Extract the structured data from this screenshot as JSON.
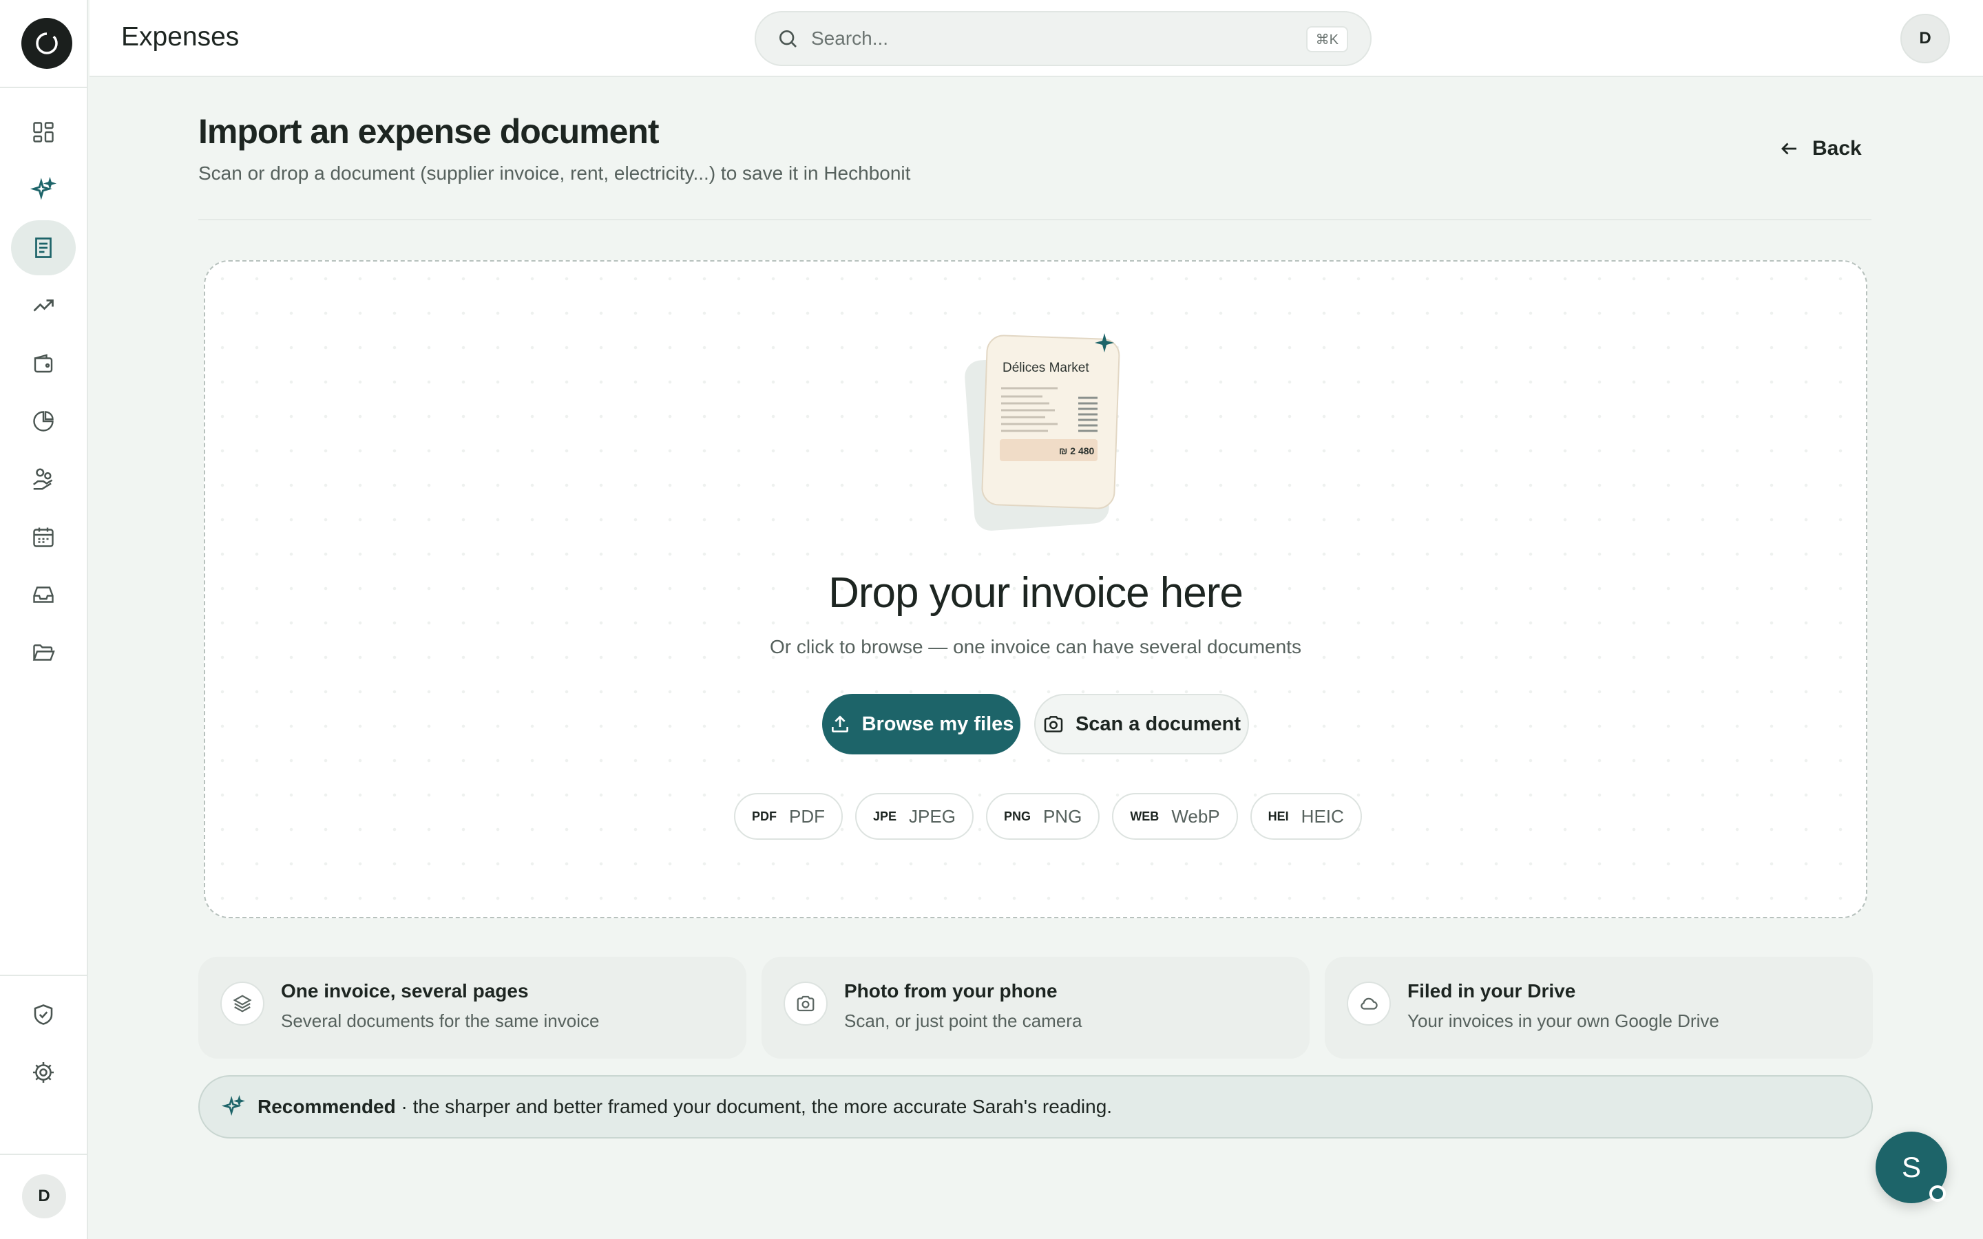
{
  "app": {
    "header_title": "Expenses",
    "user_initial": "D"
  },
  "search": {
    "placeholder": "Search...",
    "shortcut": "⌘K"
  },
  "sidebar": {
    "items": [
      {
        "name": "dashboard",
        "icon": "dashboard-grid-icon"
      },
      {
        "name": "assistant",
        "icon": "sparkles-icon"
      },
      {
        "name": "expenses",
        "icon": "receipt-document-icon",
        "active": true
      },
      {
        "name": "trends",
        "icon": "trending-up-icon"
      },
      {
        "name": "wallet",
        "icon": "wallet-icon"
      },
      {
        "name": "reports",
        "icon": "pie-chart-icon"
      },
      {
        "name": "payments",
        "icon": "hand-coins-icon"
      },
      {
        "name": "calendar",
        "icon": "calendar-icon"
      },
      {
        "name": "inbox",
        "icon": "inbox-tray-icon"
      },
      {
        "name": "files",
        "icon": "folder-open-icon"
      }
    ],
    "bottom_items": [
      {
        "name": "security",
        "icon": "shield-check-icon"
      },
      {
        "name": "settings",
        "icon": "gear-icon"
      }
    ],
    "user_initial": "D"
  },
  "page": {
    "title": "Import an expense document",
    "subtitle": "Scan or drop a document (supplier invoice, rent, electricity...) to save it in Hechbonit",
    "back_label": "Back"
  },
  "dropzone": {
    "illustration": {
      "merchant": "Délices Market",
      "amount": "₪ 2 480"
    },
    "title": "Drop your invoice here",
    "subtitle": "Or click to browse — one invoice can have several documents",
    "browse_label": "Browse my files",
    "scan_label": "Scan a document",
    "formats": [
      {
        "badge": "PDF",
        "label": "PDF"
      },
      {
        "badge": "JPE",
        "label": "JPEG"
      },
      {
        "badge": "PNG",
        "label": "PNG"
      },
      {
        "badge": "WEB",
        "label": "WebP"
      },
      {
        "badge": "HEI",
        "label": "HEIC"
      }
    ]
  },
  "features": [
    {
      "icon": "layers-icon",
      "title": "One invoice, several pages",
      "desc": "Several documents for the same invoice"
    },
    {
      "icon": "camera-icon",
      "title": "Photo from your phone",
      "desc": "Scan, or just point the camera"
    },
    {
      "icon": "cloud-icon",
      "title": "Filed in your Drive",
      "desc": "Your invoices in your own Google Drive"
    }
  ],
  "recommendation": {
    "strong": "Recommended",
    "text": "· the sharper and better framed your document, the more accurate Sarah's reading."
  },
  "assistant": {
    "initial": "S"
  },
  "colors": {
    "accent": "#1d6469",
    "background": "#f1f5f2",
    "text": "#1d2521",
    "muted": "#56615d"
  }
}
